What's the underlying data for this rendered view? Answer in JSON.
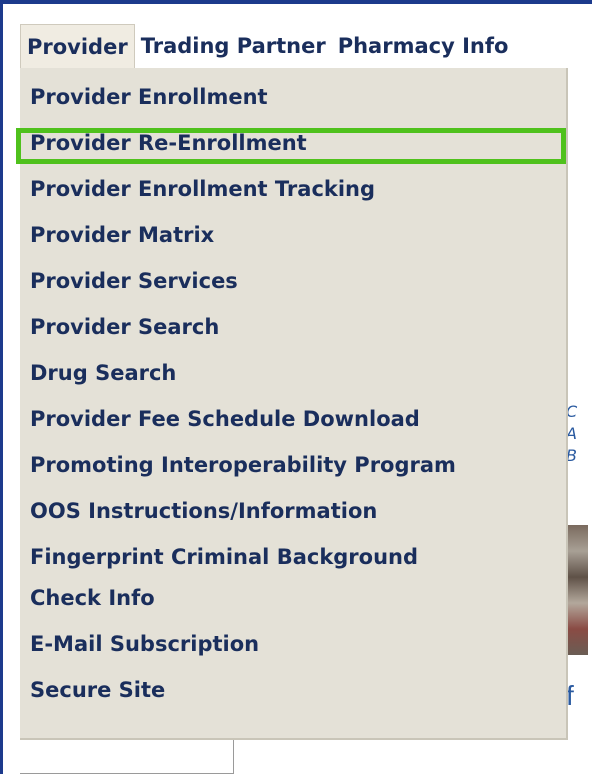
{
  "menubar": {
    "items": [
      {
        "label": "Provider",
        "active": true
      },
      {
        "label": "Trading Partner",
        "active": false
      },
      {
        "label": "Pharmacy Info",
        "active": false
      }
    ]
  },
  "dropdown": {
    "items": [
      {
        "label": "Provider Enrollment",
        "highlighted": false
      },
      {
        "label": "Provider Re-Enrollment",
        "highlighted": true
      },
      {
        "label": "Provider Enrollment Tracking",
        "highlighted": false
      },
      {
        "label": "Provider Matrix",
        "highlighted": false
      },
      {
        "label": "Provider Services",
        "highlighted": false
      },
      {
        "label": "Provider Search",
        "highlighted": false
      },
      {
        "label": "Drug Search",
        "highlighted": false
      },
      {
        "label": "Provider Fee Schedule Download",
        "highlighted": false
      },
      {
        "label": "Promoting Interoperability Program",
        "highlighted": false
      },
      {
        "label": "OOS Instructions/Information",
        "highlighted": false
      },
      {
        "label": "Fingerprint Criminal Background",
        "highlighted": false
      },
      {
        "label": "Check Info",
        "highlighted": false
      },
      {
        "label": "E-Mail Subscription",
        "highlighted": false
      },
      {
        "label": "Secure Site",
        "highlighted": false
      }
    ]
  },
  "background": {
    "partial_text_lines": [
      "C",
      "A",
      "B"
    ],
    "partial_glyph": "f"
  },
  "colors": {
    "menu_text": "#1a2e5c",
    "dropdown_bg": "#e4e1d7",
    "highlight_border": "#4fc11c",
    "top_rule": "#1c3a8c"
  }
}
